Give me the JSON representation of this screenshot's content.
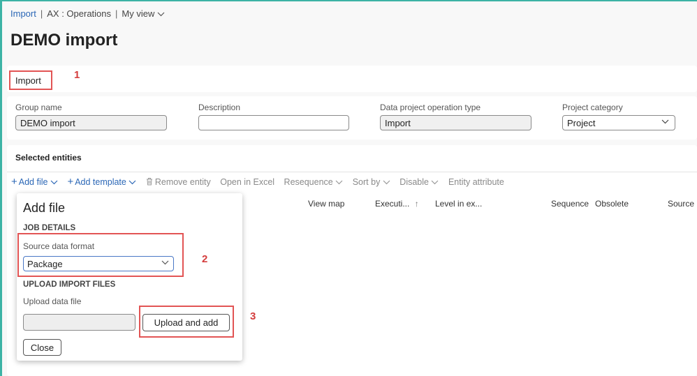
{
  "breadcrumb": {
    "item1": "Import",
    "item2": "AX : Operations",
    "item3": "My view"
  },
  "page_title": "DEMO import",
  "tab": {
    "label": "Import",
    "marker": "1"
  },
  "fields": {
    "group_name": {
      "label": "Group name",
      "value": "DEMO import"
    },
    "description": {
      "label": "Description",
      "value": ""
    },
    "operation_type": {
      "label": "Data project operation type",
      "value": "Import"
    },
    "project_category": {
      "label": "Project category",
      "value": "Project"
    }
  },
  "section_title": "Selected entities",
  "toolbar": {
    "add_file": "Add file",
    "add_template": "Add template",
    "remove_entity": "Remove entity",
    "open_in_excel": "Open in Excel",
    "resequence": "Resequence",
    "sort_by": "Sort by",
    "disable": "Disable",
    "entity_attribute": "Entity attribute"
  },
  "columns": {
    "view_map": "View map",
    "execution": "Executi...",
    "sort_arrow": "↑",
    "level": "Level in ex...",
    "sequence": "Sequence",
    "obsolete": "Obsolete",
    "source": "Source"
  },
  "add_file_panel": {
    "title": "Add file",
    "job_details": "JOB DETAILS",
    "source_format_label": "Source data format",
    "source_format_value": "Package",
    "marker2": "2",
    "upload_heading": "UPLOAD IMPORT FILES",
    "upload_label": "Upload data file",
    "upload_button": "Upload and add",
    "marker3": "3",
    "close_button": "Close"
  },
  "colors": {
    "accent": "#2b67b6",
    "highlight": "#e25454",
    "border_teal": "#3db3a5"
  }
}
